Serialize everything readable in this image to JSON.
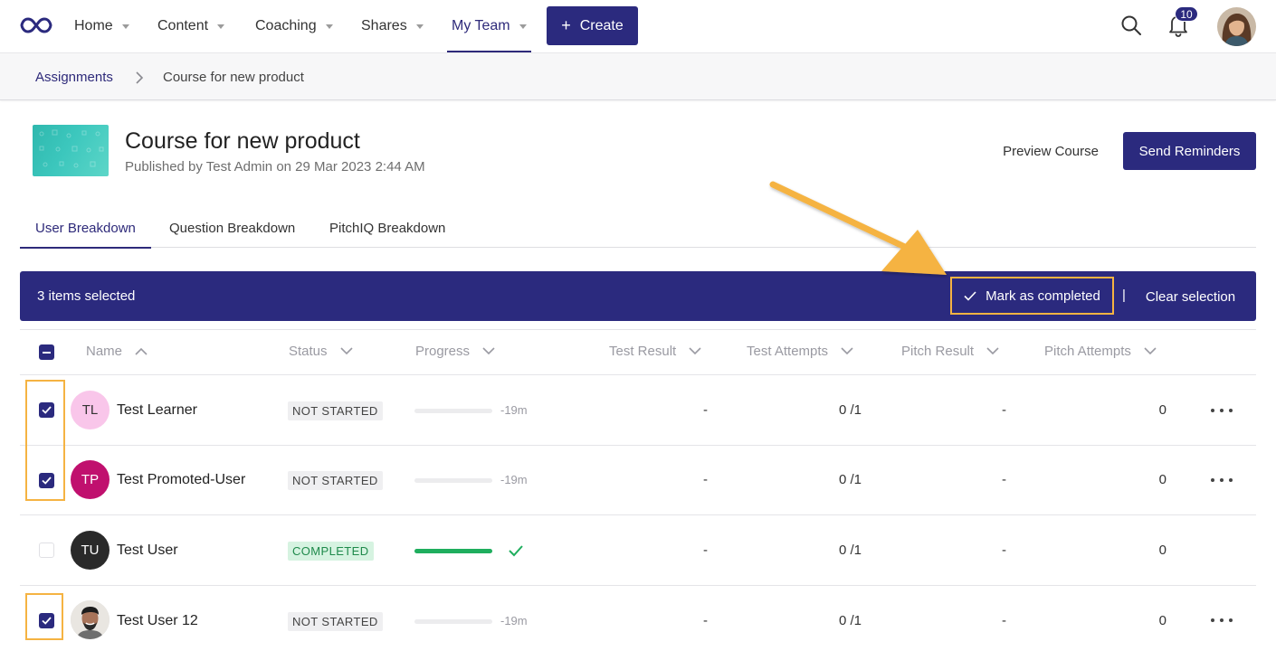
{
  "nav": {
    "items": [
      {
        "label": "Home"
      },
      {
        "label": "Content"
      },
      {
        "label": "Coaching"
      },
      {
        "label": "Shares"
      },
      {
        "label": "My Team"
      }
    ],
    "create_label": "Create",
    "notification_count": "10"
  },
  "breadcrumb": {
    "parent": "Assignments",
    "current": "Course for new product"
  },
  "course": {
    "title": "Course for new product",
    "subtitle": "Published by Test Admin on 29 Mar 2023 2:44 AM",
    "preview_label": "Preview Course",
    "send_label": "Send Reminders"
  },
  "tabs": [
    {
      "label": "User Breakdown"
    },
    {
      "label": "Question Breakdown"
    },
    {
      "label": "PitchIQ Breakdown"
    }
  ],
  "selection": {
    "count_text": "3 items selected",
    "mark_label": "Mark as completed",
    "separator": "|",
    "clear_label": "Clear selection"
  },
  "table": {
    "columns": {
      "name": "Name",
      "status": "Status",
      "progress": "Progress",
      "test_result": "Test Result",
      "test_attempts": "Test Attempts",
      "pitch_result": "Pitch Result",
      "pitch_attempts": "Pitch Attempts"
    },
    "rows": [
      {
        "initials": "TL",
        "name": "Test Learner",
        "status": "NOT STARTED",
        "progress_text": "-19m",
        "progress": 0,
        "test_result": "-",
        "test_attempts": "0 /1",
        "pitch_result": "-",
        "pitch_attempts": "0",
        "checked": true
      },
      {
        "initials": "TP",
        "name": "Test Promoted-User",
        "status": "NOT STARTED",
        "progress_text": "-19m",
        "progress": 0,
        "test_result": "-",
        "test_attempts": "0 /1",
        "pitch_result": "-",
        "pitch_attempts": "0",
        "checked": true
      },
      {
        "initials": "TU",
        "name": "Test User",
        "status": "COMPLETED",
        "progress_text": "",
        "progress": 1,
        "test_result": "-",
        "test_attempts": "0 /1",
        "pitch_result": "-",
        "pitch_attempts": "0",
        "checked": false
      },
      {
        "initials": "",
        "name": "Test User 12",
        "status": "NOT STARTED",
        "progress_text": "-19m",
        "progress": 0,
        "test_result": "-",
        "test_attempts": "0 /1",
        "pitch_result": "-",
        "pitch_attempts": "0",
        "checked": true
      }
    ]
  },
  "colors": {
    "brand": "#2b2a7e",
    "highlight": "#f5b342",
    "success": "#1fae5e",
    "avatar_tl": "#f9c6ea",
    "avatar_tp": "#c0106e",
    "avatar_tu": "#2a2a2a"
  },
  "icons": [
    "logo-icon",
    "search-icon",
    "bell-icon",
    "chevron-right-icon",
    "check-icon",
    "chevron-down-icon",
    "chevron-up-icon",
    "more-dots-icon",
    "arrow-annotation"
  ]
}
